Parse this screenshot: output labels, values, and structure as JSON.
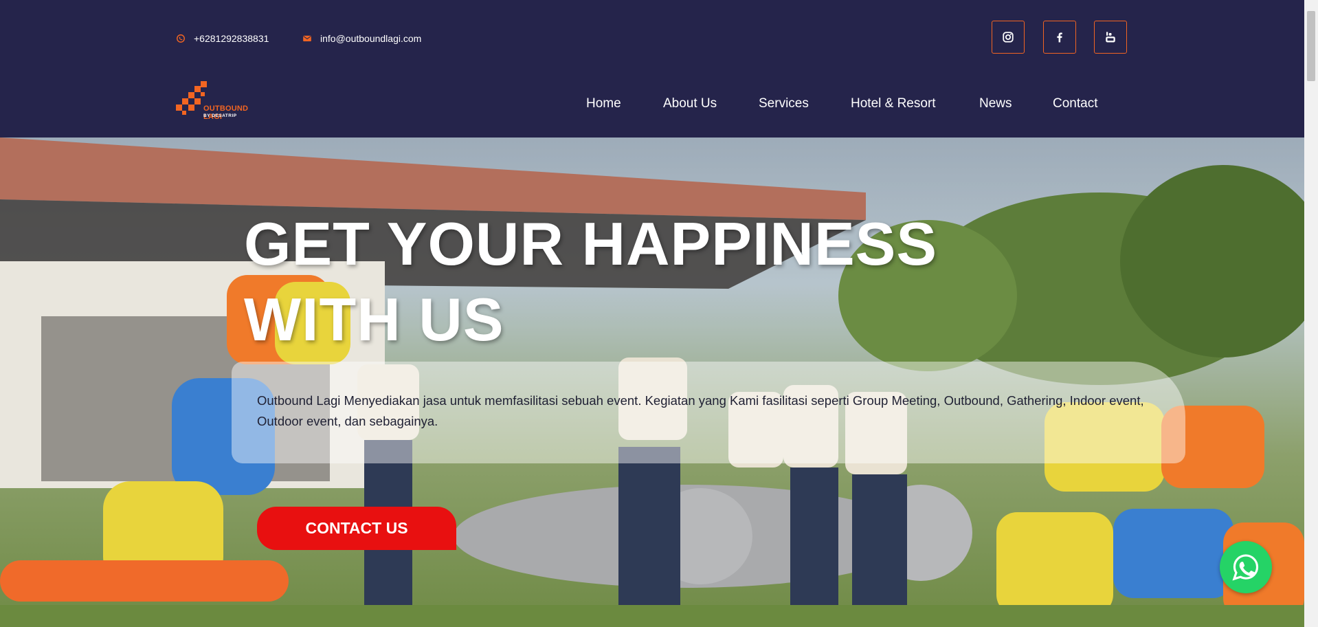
{
  "topbar": {
    "phone": "+6281292838831",
    "email": "info@outboundlagi.com",
    "social": [
      {
        "name": "instagram",
        "icon": "instagram-icon"
      },
      {
        "name": "facebook",
        "icon": "facebook-icon"
      },
      {
        "name": "youtube",
        "icon": "youtube-icon"
      }
    ]
  },
  "logo": {
    "brand": "OUTBOUND LAGI",
    "sub": "BY DESATRIP"
  },
  "nav": {
    "items": [
      "Home",
      "About Us",
      "Services",
      "Hotel & Resort",
      "News",
      "Contact"
    ]
  },
  "hero": {
    "headline_line1": "GET YOUR HAPPINESS",
    "headline_line2": "WITH US",
    "description": "Outbound Lagi Menyediakan jasa untuk memfasilitasi sebuah event. Kegiatan yang Kami fasilitasi seperti Group Meeting, Outbound, Gathering, Indoor event, Outdoor event, dan sebagainya.",
    "cta_label": "CONTACT US"
  },
  "floating": {
    "whatsapp_icon": "whatsapp-icon"
  },
  "colors": {
    "navy": "#25244b",
    "accent_orange": "#f26522",
    "cta_red": "#e81010",
    "whatsapp_green": "#25d366"
  }
}
